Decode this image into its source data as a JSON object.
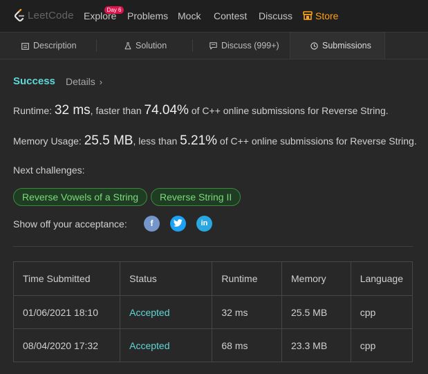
{
  "nav": {
    "logo_text": "LeetCode",
    "badge": "Day 6",
    "items": [
      "Explore",
      "Problems",
      "Mock",
      "Contest",
      "Discuss"
    ],
    "store": "Store",
    "accent": "#ffa116"
  },
  "tabs": [
    {
      "label": "Description",
      "icon": "document-icon"
    },
    {
      "label": "Solution",
      "icon": "flask-icon"
    },
    {
      "label": "Discuss (999+)",
      "icon": "comment-icon"
    },
    {
      "label": "Submissions",
      "icon": "clock-icon",
      "active": true
    }
  ],
  "result": {
    "status": "Success",
    "details_label": "Details"
  },
  "runtime": {
    "prefix": "Runtime: ",
    "value": "32 ms",
    "middle": ", faster than ",
    "percent": "74.04%",
    "suffix": " of C++ online submissions for Reverse String."
  },
  "memory": {
    "prefix": "Memory Usage: ",
    "value": "25.5 MB",
    "middle": ", less than ",
    "percent": "5.21%",
    "suffix": " of C++ online submissions for Reverse String."
  },
  "next": {
    "label": "Next challenges:",
    "challenges": [
      "Reverse Vowels of a String",
      "Reverse String II"
    ]
  },
  "share": {
    "label": "Show off your acceptance:",
    "networks": [
      "facebook",
      "twitter",
      "linkedin"
    ]
  },
  "table": {
    "headers": [
      "Time Submitted",
      "Status",
      "Runtime",
      "Memory",
      "Language"
    ],
    "rows": [
      [
        "01/06/2021 18:10",
        "Accepted",
        "32 ms",
        "25.5 MB",
        "cpp"
      ],
      [
        "08/04/2020 17:32",
        "Accepted",
        "68 ms",
        "23.3 MB",
        "cpp"
      ]
    ]
  },
  "colors": {
    "success": "#5fd7d7",
    "challenge_text": "#7fd87f",
    "badge": "#e0144c",
    "facebook": "#7496c9",
    "twitter": "#1da1f2",
    "linkedin": "#2aa7e0"
  }
}
